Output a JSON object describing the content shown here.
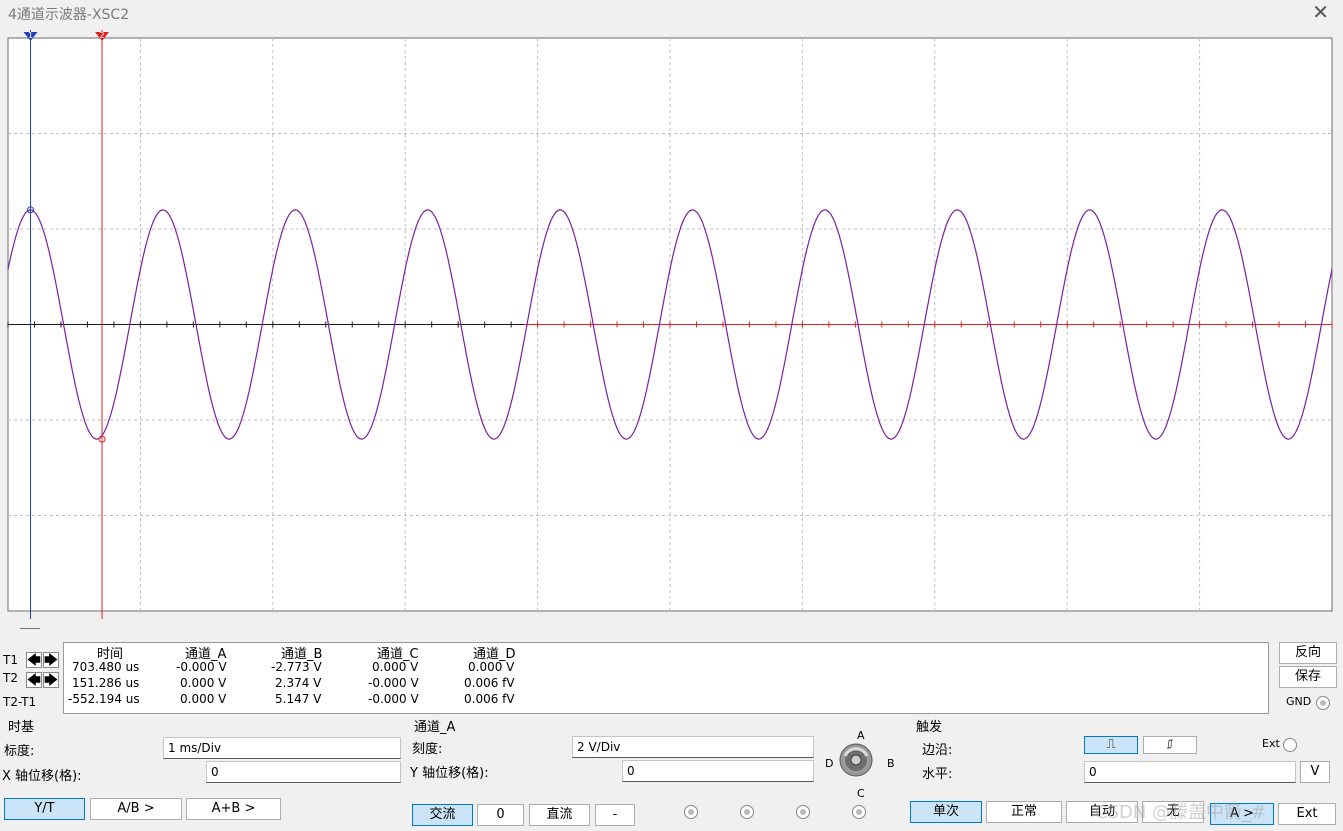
{
  "window": {
    "title": "4通道示波器-XSC2"
  },
  "colors": {
    "trace": "#7b1fa2",
    "cursor_t1": "#1f3fbf",
    "cursor_t2": "#e02020",
    "grid": "#bfbfbf",
    "axis": "#1a1a1a",
    "axis_b": "#e02020"
  },
  "screen": {
    "cursor_t1_label": "1",
    "cursor_t2_label": "2",
    "divisions_x": 10,
    "divisions_y": 6
  },
  "chart_data": {
    "type": "line",
    "title": "",
    "xlabel": "",
    "ylabel": "",
    "time_per_div_ms": 1,
    "volts_per_div": 2,
    "series": [
      {
        "channel": "A",
        "amplitude_v": 2.4,
        "period_ms": 1.0,
        "phase_note": "peak near T1",
        "color": "#7b1fa2"
      }
    ],
    "xlim_ms": [
      0,
      10
    ],
    "ylim_v": [
      -6,
      6
    ]
  },
  "readout": {
    "headers": [
      "时间",
      "通道_A",
      "通道_B",
      "通道_C",
      "通道_D"
    ],
    "rows": [
      {
        "label": "T1",
        "values": [
          "703.480 us",
          "-0.000 V",
          "-2.773 V",
          "0.000 V",
          "0.000 V"
        ]
      },
      {
        "label": "T2",
        "values": [
          "151.286 us",
          "0.000 V",
          "2.374 V",
          "-0.000 V",
          "0.006 fV"
        ]
      },
      {
        "label": "T2-T1",
        "values": [
          "-552.194 us",
          "0.000 V",
          "5.147 V",
          "-0.000 V",
          "0.006 fV"
        ]
      }
    ],
    "reverse_label": "反向",
    "save_label": "保存",
    "gnd_label": "GND"
  },
  "timebase": {
    "group_label": "时基",
    "scale_label": "标度:",
    "scale_value": "1 ms/Div",
    "xpos_label": "X 轴位移(格):",
    "xpos_value": "0",
    "mode_buttons": [
      "Y/T",
      "A/B >",
      "A+B >"
    ]
  },
  "channel": {
    "group_label": "通道_A",
    "scale_label": "刻度:",
    "scale_value": "2  V/Div",
    "ypos_label": "Y 轴位移(格):",
    "ypos_value": "0",
    "coupling_buttons": [
      "交流",
      "0",
      "直流",
      "-"
    ],
    "selector": {
      "a": "A",
      "b": "B",
      "c": "C",
      "d": "D"
    }
  },
  "trigger": {
    "group_label": "触发",
    "edge_label": "边沿:",
    "level_label": "水平:",
    "level_value": "0",
    "level_unit": "V",
    "ext_label": "Ext",
    "mode_buttons": [
      "单次",
      "正常",
      "自动",
      "无"
    ],
    "source_buttons": [
      "A >",
      "Ext"
    ]
  },
  "watermark": "CSDN @滕盖中箭_#"
}
